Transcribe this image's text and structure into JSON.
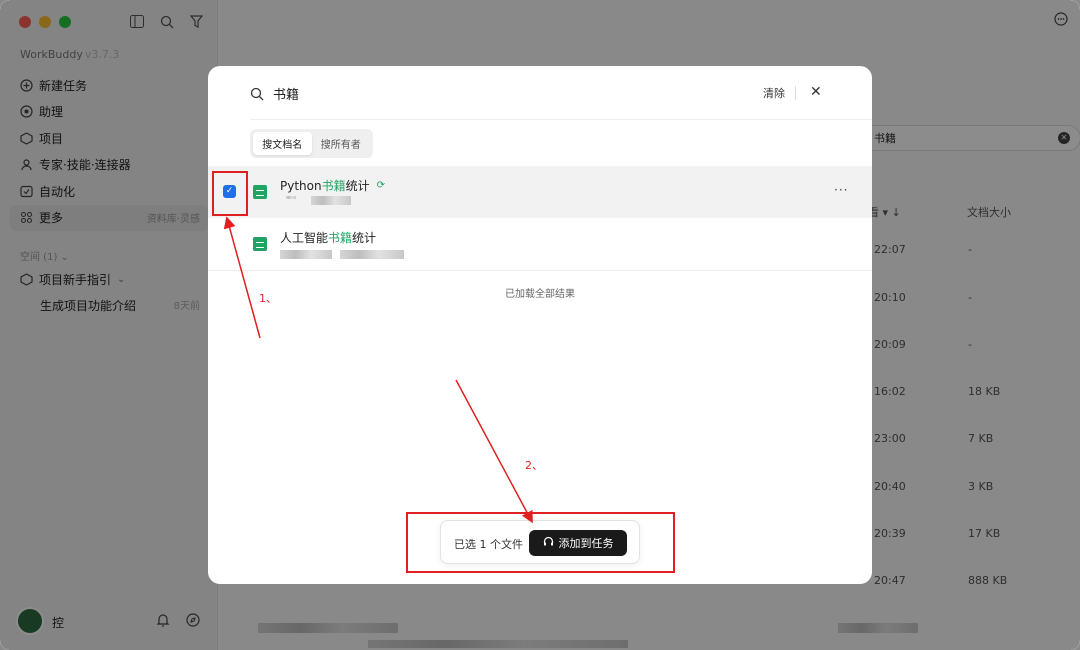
{
  "sidebar": {
    "app_title": "WorkBuddy",
    "app_version": "v3.7.3",
    "nav": [
      {
        "label": "新建任务",
        "icon": "plus-circle-icon"
      },
      {
        "label": "助理",
        "icon": "assistant-icon"
      },
      {
        "label": "项目",
        "icon": "project-icon"
      },
      {
        "label": "专家·技能·连接器",
        "icon": "expert-icon"
      },
      {
        "label": "自动化",
        "icon": "automation-icon"
      },
      {
        "label": "更多",
        "icon": "grid-icon",
        "extra": "资料库·灵感"
      }
    ],
    "space_header": "空间 (1) ⌄",
    "project_label": "项目新手指引",
    "sub_item": {
      "label": "生成项目功能介绍",
      "time": "8天前"
    },
    "user_name": "控"
  },
  "background": {
    "search_value": "书籍",
    "columns": {
      "sort_col": "看 ▾  ↓",
      "size": "文档大小"
    },
    "rows": [
      {
        "time": "22:07",
        "size": "-"
      },
      {
        "time": "20:10",
        "size": "-"
      },
      {
        "time": "20:09",
        "size": "-"
      },
      {
        "time": "16:02",
        "size": "18 KB"
      },
      {
        "time": "23:00",
        "size": "7 KB"
      },
      {
        "time": "20:40",
        "size": "3 KB"
      },
      {
        "time": "20:39",
        "size": "17 KB"
      },
      {
        "time": "20:47",
        "size": "888 KB"
      }
    ]
  },
  "modal": {
    "search_value": "书籍",
    "clear_label": "清除",
    "close_symbol": "✕",
    "tabs": [
      {
        "label": "搜文档名",
        "active": true
      },
      {
        "label": "搜所有者",
        "active": false
      }
    ],
    "results": [
      {
        "prefix": "Python",
        "highlight": "书籍",
        "suffix": "统计",
        "checked": true,
        "synced": true
      },
      {
        "prefix": "人工智能",
        "highlight": "书籍",
        "suffix": "统计",
        "checked": false,
        "synced": false
      }
    ],
    "more_symbol": "···",
    "loaded_text": "已加载全部结果",
    "selected_count_text": "已选 1 个文件",
    "add_button_label": "添加到任务"
  },
  "annotations": {
    "step1": "1、",
    "step2": "2、",
    "color": "#e02020"
  }
}
